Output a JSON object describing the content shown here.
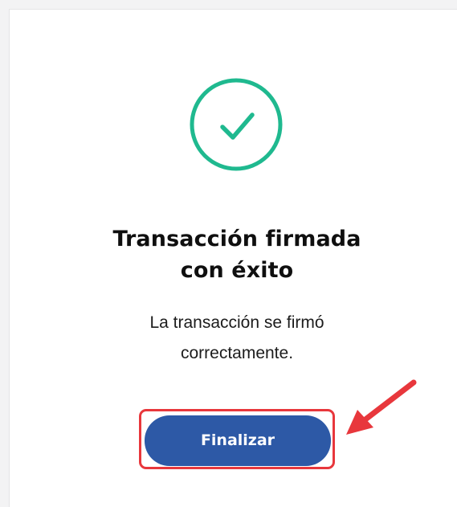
{
  "dialog": {
    "status_icon": "check-circle-icon",
    "title_lines": [
      "Transacción firmada",
      "con éxito"
    ],
    "message_lines": [
      "La transacción se firmó",
      "correctamente."
    ],
    "finish_label": "Finalizar"
  },
  "annotation": {
    "highlight": "red-highlight-box",
    "pointer": "red-arrow-icon"
  },
  "colors": {
    "success": "#1fb98f",
    "button": "#2d59a6",
    "annotation": "#e8373c"
  }
}
